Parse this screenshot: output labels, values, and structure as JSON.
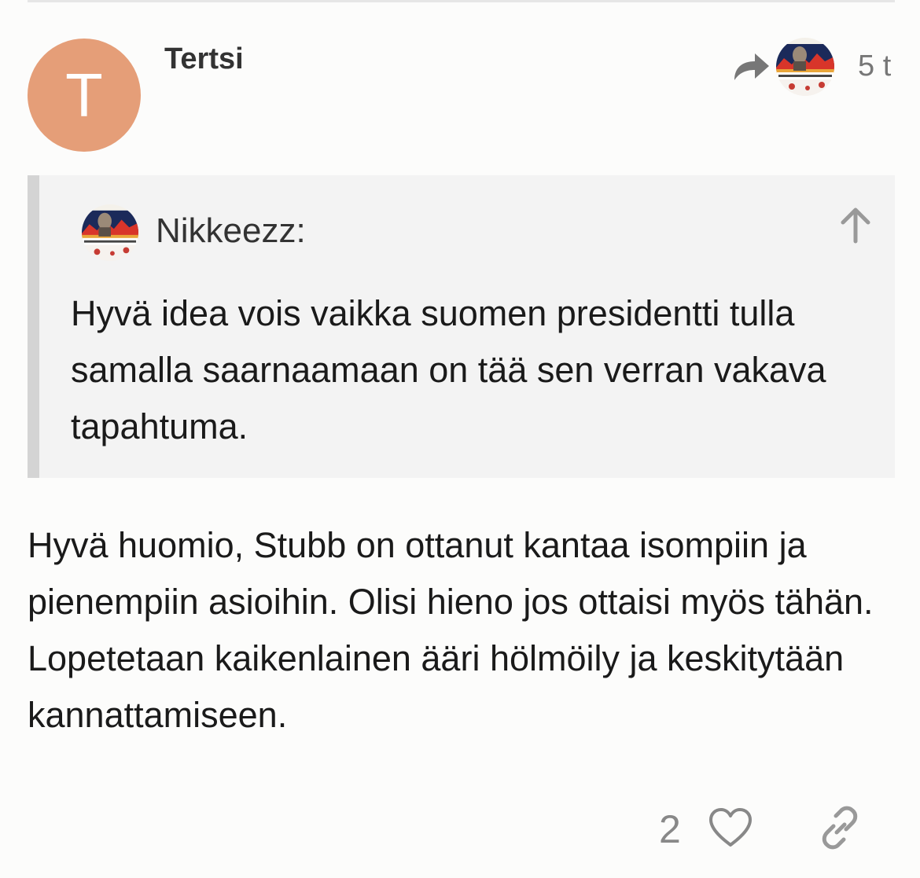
{
  "post": {
    "avatar_letter": "T",
    "avatar_color": "#e59e78",
    "username": "Tertsi",
    "reply_icon": "share-reply-icon",
    "date": "5 t",
    "quote": {
      "username": "Nikkeezz:",
      "expand_icon": "arrow-up-icon",
      "text": "Hyvä idea vois vaikka suomen presidentti tulla samalla saarnaamaan on tää sen verran vakava tapahtuma."
    },
    "body": "Hyvä huomio, Stubb on ottanut kantaa isompiin ja pienempiin asioihin. Olisi hieno jos ottaisi myös tähän. Lopetetaan kaikenlainen ääri hölmöily ja keskitytään kannattamiseen.",
    "actions": {
      "like_count": "2",
      "like_icon": "heart-icon",
      "link_icon": "link-icon"
    }
  }
}
